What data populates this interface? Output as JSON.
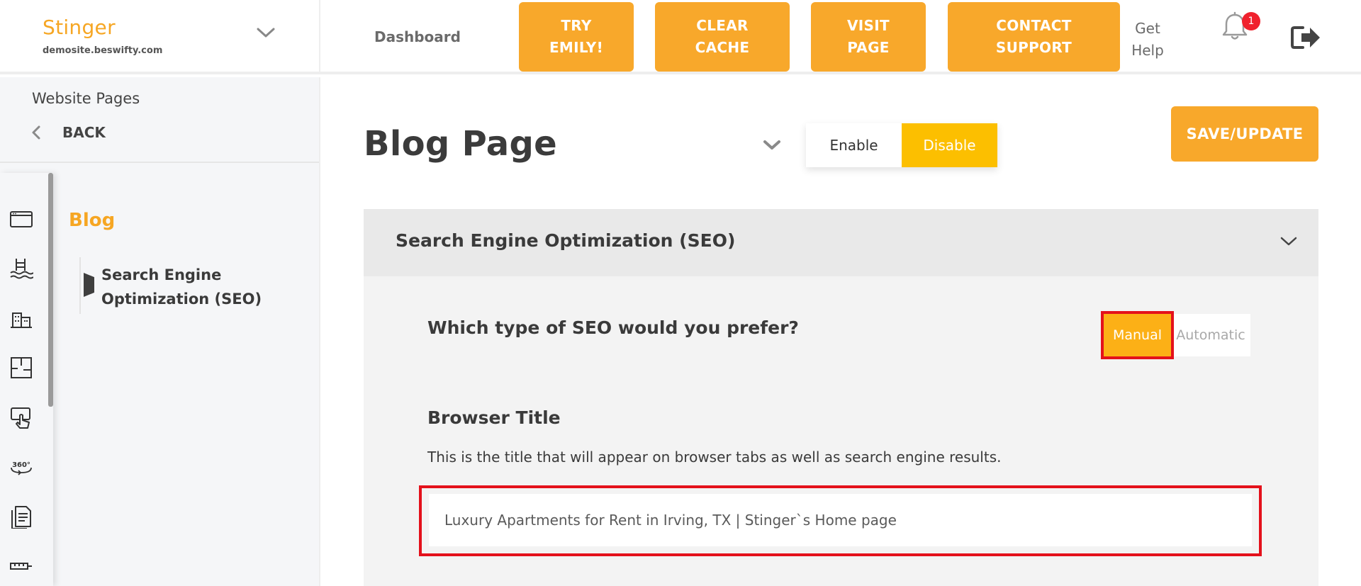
{
  "brand": {
    "name": "Stinger",
    "domain": "demosite.beswifty.com"
  },
  "topnav": {
    "dashboard": "Dashboard",
    "buttons": {
      "try_emily": "TRY\nEMILY!",
      "clear_cache": "CLEAR\nCACHE",
      "visit_page": "VISIT\nPAGE",
      "contact_support": "CONTACT\nSUPPORT"
    },
    "get_help": "Get\nHelp",
    "notification_count": "1",
    "accent_color": "#f8a82b",
    "badge_color": "#f0212d"
  },
  "sidebar": {
    "title": "Website Pages",
    "back_label": "BACK",
    "section": "Blog",
    "subitem": "Search Engine Optimization (SEO)",
    "rail_icons": [
      "browser-window-icon",
      "pool-icon",
      "buildings-icon",
      "floorplan-icon",
      "touch-screen-icon",
      "360-view-icon",
      "document-icon",
      "ruler-icon"
    ]
  },
  "main": {
    "page_title": "Blog Page",
    "status_toggle": {
      "enable": "Enable",
      "disable": "Disable",
      "active": "Disable"
    },
    "save_button": "SAVE/UPDATE",
    "seo": {
      "header": "Search Engine Optimization (SEO)",
      "question": "Which type of SEO would you prefer?",
      "options": {
        "manual": "Manual",
        "automatic": "Automatic"
      },
      "selected": "Manual",
      "browser_title": {
        "label": "Browser Title",
        "description": "This is the title that will appear on browser tabs as well as search engine results.",
        "value": "Luxury Apartments for Rent in Irving, TX | Stinger`s Home page"
      }
    }
  }
}
